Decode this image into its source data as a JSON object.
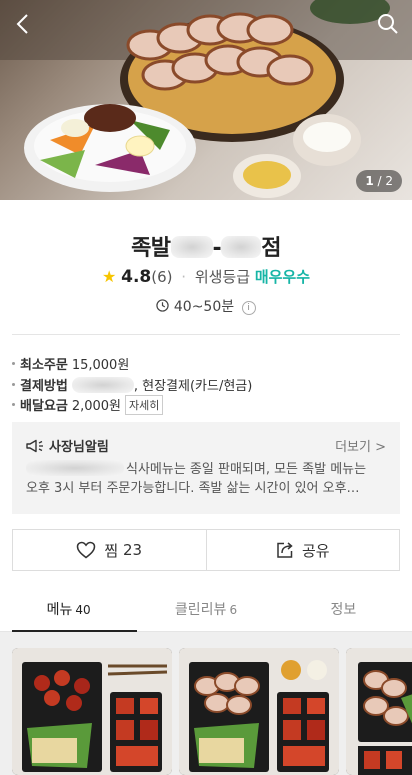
{
  "hero": {
    "pager_current": "1",
    "pager_total": "/ 2",
    "icons": {
      "back": "chevron-left-icon",
      "search": "search-icon"
    }
  },
  "store": {
    "name_prefix": "족발",
    "name_middle": "-",
    "name_suffix": "점",
    "rating": "4.8",
    "review_count": "(6)",
    "hygiene_label": "위생등급",
    "hygiene_grade": "매우우수",
    "delivery_time": "40~50분",
    "colors": {
      "star": "#f7c500",
      "grade": "#16b5a6"
    }
  },
  "details": {
    "min_order_label": "최소주문",
    "min_order_value": "15,000원",
    "payment_label": "결제방법",
    "payment_value": ", 현장결제(카드/현금)",
    "fee_label": "배달요금",
    "fee_value": "2,000원",
    "fee_detail_button": "자세히"
  },
  "notice": {
    "title": "사장님알림",
    "more": "더보기 >",
    "line1": "식사메뉴는 종일 판매되며, 모든 족발 메뉴는",
    "line2": "오후 3시 부터 주문가능합니다. 족발 삶는 시간이 있어 오후…"
  },
  "actions": {
    "like_label": "찜",
    "like_count": "23",
    "share_label": "공유"
  },
  "tabs": [
    {
      "label": "메뉴",
      "count": "40"
    },
    {
      "label": "클린리뷰",
      "count": "6"
    },
    {
      "label": "정보",
      "count": ""
    }
  ]
}
